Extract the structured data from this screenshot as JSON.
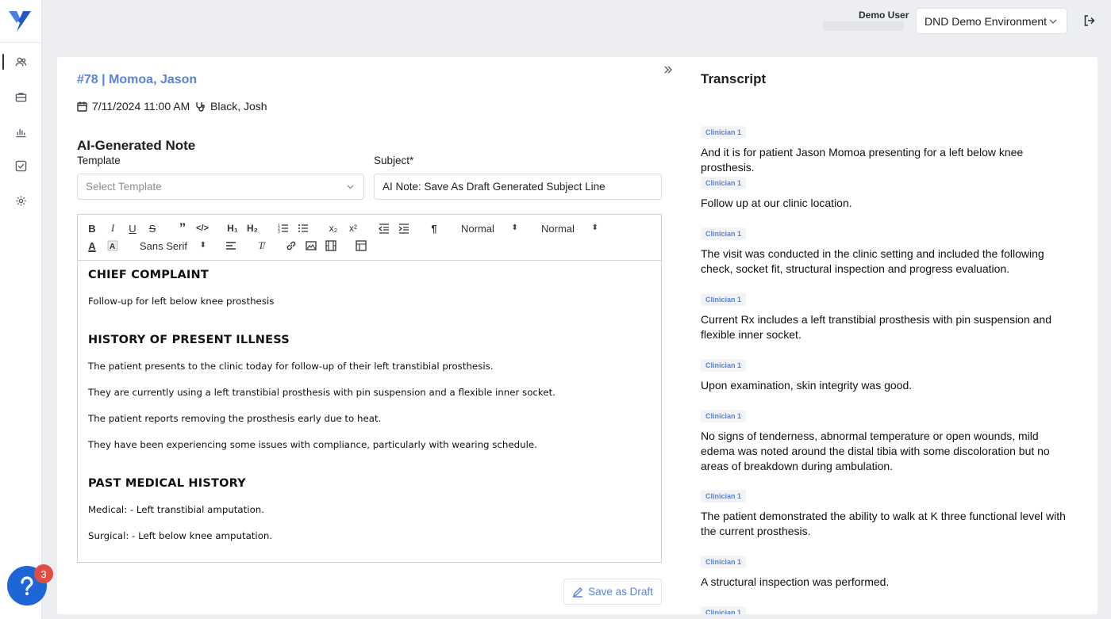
{
  "app": {
    "user_name": "Demo User",
    "environment": "DND Demo Environment",
    "help_count": "3",
    "brand_color": "#1c66d6"
  },
  "nav": [
    {
      "icon": "users-icon",
      "active": true
    },
    {
      "icon": "briefcase-icon",
      "active": false
    },
    {
      "icon": "bar-chart-icon",
      "active": false
    },
    {
      "icon": "check-square-icon",
      "active": false
    },
    {
      "icon": "gear-icon",
      "active": false
    }
  ],
  "encounter": {
    "title": "#78 | Momoa, Jason",
    "datetime": "7/11/2024 11:00 AM",
    "clinician": "Black, Josh"
  },
  "note": {
    "section_title": "AI-Generated Note",
    "template_label": "Template",
    "template_placeholder": "Select Template",
    "subject_label": "Subject*",
    "subject_value": "AI Note: Save As Draft Generated Subject Line",
    "toolbar": {
      "header_select": "Normal",
      "size_select": "Normal",
      "font_select": "Sans Serif"
    },
    "body": {
      "h1": "CHIEF COMPLAINT",
      "p1": "Follow-up for left below knee prosthesis",
      "h2": "HISTORY OF PRESENT ILLNESS",
      "p2": "The patient presents to the clinic today for follow-up of their left transtibial prosthesis.",
      "p3": "They are currently using a left transtibial prosthesis with pin suspension and a flexible inner socket.",
      "p4": "The patient reports removing the prosthesis early due to heat.",
      "p5": "They have been experiencing some issues with compliance, particularly with wearing schedule.",
      "h3": "PAST MEDICAL HISTORY",
      "p6": "Medical: - Left transtibial amputation.",
      "p7": "Surgical: - Left below knee amputation."
    },
    "save_label": "Save as Draft"
  },
  "transcript": {
    "title": "Transcript",
    "speaker": "Clinician 1",
    "u1": "And it is for patient Jason Momoa presenting for a left below knee prosthesis.",
    "u2": "Follow up at our clinic location.",
    "u3": "The visit was conducted in the clinic setting and included the following check, socket fit, structural inspection and progress evaluation.",
    "u4": "Current Rx includes a left transtibial prosthesis with pin suspension and flexible inner socket.",
    "u5": "Upon examination, skin integrity was good.",
    "u6": "No signs of tenderness, abnormal temperature or open wounds, mild edema was noted around the distal tibia with some discoloration but no areas of breakdown during ambulation.",
    "u7": "The patient demonstrated the ability to walk at K three functional level with the current prosthesis.",
    "u8": "A structural inspection was performed."
  }
}
